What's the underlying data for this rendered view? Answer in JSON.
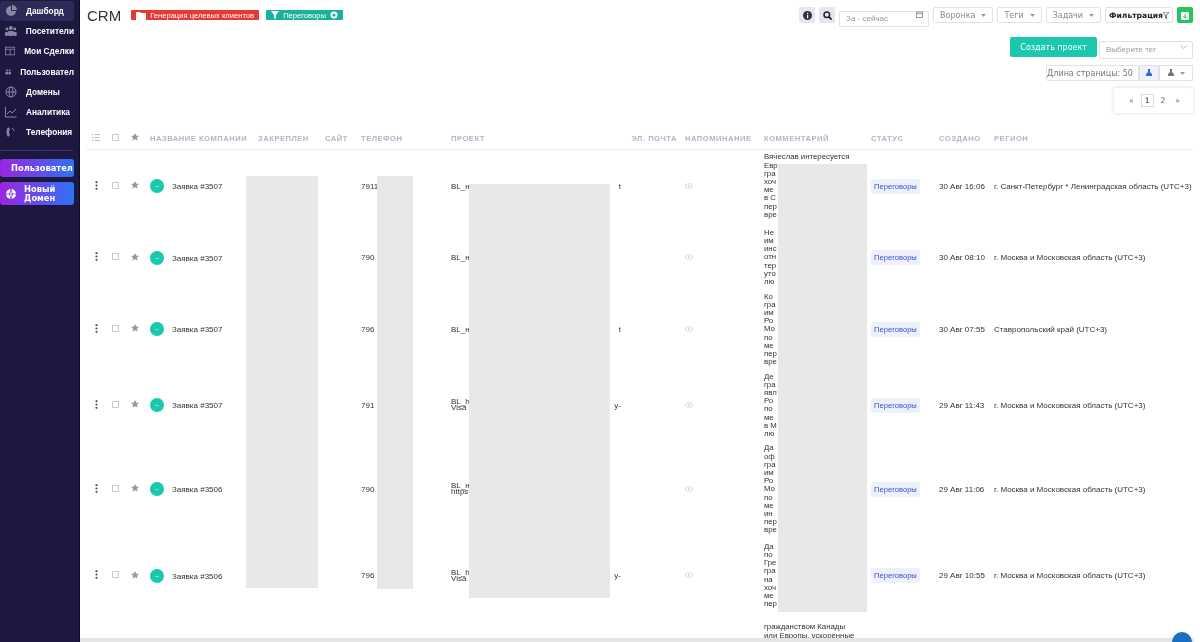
{
  "sidebar": {
    "items": [
      {
        "label": "Дашборд",
        "selected": true
      },
      {
        "label": "Посетители",
        "selected": false
      },
      {
        "label": "Мои Сделки",
        "selected": false
      },
      {
        "label": "Пользовател",
        "selected": false
      },
      {
        "label": "Домены",
        "selected": false
      },
      {
        "label": "Аналитика",
        "selected": false
      },
      {
        "label": "Телефония",
        "selected": false
      }
    ],
    "buttons": [
      {
        "label": "Пользовател"
      },
      {
        "label": "Новый Домен"
      }
    ]
  },
  "header": {
    "title": "CRM",
    "tags": [
      {
        "label": "Генерация целевых клиентов",
        "color": "#e53935"
      },
      {
        "label": "Переговоры",
        "color": "#19b39b"
      }
    ]
  },
  "toolbar": {
    "date_field": {
      "placeholder": "За - сейчас"
    },
    "dropdowns": [
      "Воронка",
      "Теги",
      "Задачи"
    ],
    "filter_button": "Фильтрация",
    "create_button": "Создать проект",
    "tag_select": {
      "placeholder": "Выберите тег"
    },
    "page_length": "Длина страницы: 50"
  },
  "pagination": {
    "prev": "«",
    "pages": [
      {
        "label": "1",
        "selected": true
      },
      {
        "label": "2",
        "selected": false
      }
    ],
    "next": "»"
  },
  "table": {
    "select_all_checked": false,
    "columns": [
      "НАЗВАНИЕ КОМПАНИИ",
      "ЗАКРЕПЛЕН",
      "САЙТ",
      "ТЕЛЕФОН",
      "ПРОЕКТ",
      "ЭЛ. ПОЧТА",
      "НАПОМИНАНИЕ",
      "КОММЕНТАРИЙ",
      "СТАТУС",
      "СОЗДАНО",
      "РЕГИОН"
    ],
    "rows": [
      {
        "checked": false,
        "starred": false,
        "avatar": "--",
        "name": "Заявка #3507",
        "phone": "7911",
        "project": [
          "BL_н"
        ],
        "project_tail": "t",
        "comment": [
          "Вячеслав интересуется",
          "Евр",
          "гра",
          "хоч",
          "ме",
          "в С",
          "пер",
          "вре"
        ],
        "status": "Переговоры",
        "created": "30 Авг 16:06",
        "region": "г. Санкт-Петербург * Ленинградская область (UTC+3)"
      },
      {
        "checked": false,
        "starred": false,
        "avatar": "--",
        "name": "Заявка #3507",
        "phone": "790",
        "project": [
          "BL_н"
        ],
        "comment": [
          "Не",
          "им",
          "инс",
          "отн",
          "тер",
          "уто",
          "лю"
        ],
        "status": "Переговоры",
        "created": "30 Авг 08:10",
        "region": "г. Москва и Московская область (UTC+3)"
      },
      {
        "checked": false,
        "starred": false,
        "avatar": "--",
        "name": "Заявка #3507",
        "phone": "796",
        "project": [
          "BL_н"
        ],
        "project_tail": "t",
        "comment": [
          "Ко",
          "гра",
          "им",
          "Ро",
          "Мо",
          "по",
          "ме",
          "пер",
          "вре"
        ],
        "status": "Переговоры",
        "created": "30 Авг 07:55",
        "region": "Ставропольский край (UTC+3)"
      },
      {
        "checked": false,
        "starred": false,
        "avatar": "--",
        "name": "Заявка #3507",
        "phone": "791",
        "project": [
          "BL_h",
          "Visa"
        ],
        "project_tail": "y-",
        "comment": [
          "Де",
          "гра",
          "явл",
          "Ро",
          "по",
          "ме",
          "в М",
          "лю"
        ],
        "status": "Переговоры",
        "created": "29 Авг 11:43",
        "region": "г. Москва и Московская область (UTC+3)"
      },
      {
        "checked": false,
        "starred": false,
        "avatar": "--",
        "name": "Заявка #3506",
        "phone": "790",
        "project": [
          "BL_н",
          "https"
        ],
        "comment": [
          "Да",
          "оф",
          "гра",
          "им",
          "Ро",
          "Мо",
          "по",
          "ме",
          "ин",
          "пер",
          "вре"
        ],
        "status": "Переговоры",
        "created": "29 Авг 11:06",
        "region": "г. Москва и Московская область (UTC+3)"
      },
      {
        "checked": false,
        "starred": false,
        "avatar": "--",
        "name": "Заявка #3506",
        "phone": "796",
        "project": [
          "BL_h",
          "Visa"
        ],
        "project_tail": "y-",
        "comment": [
          "Да",
          "по",
          "Гре",
          "гра",
          "на",
          "хоч",
          "ме",
          "пер"
        ],
        "status": "Переговоры",
        "created": "29 Авг 10:55",
        "region": "г. Москва и Московская область (UTC+3)"
      },
      {
        "comment": [
          "гражданством Канады",
          "или Европы, ускоренные"
        ]
      }
    ]
  }
}
